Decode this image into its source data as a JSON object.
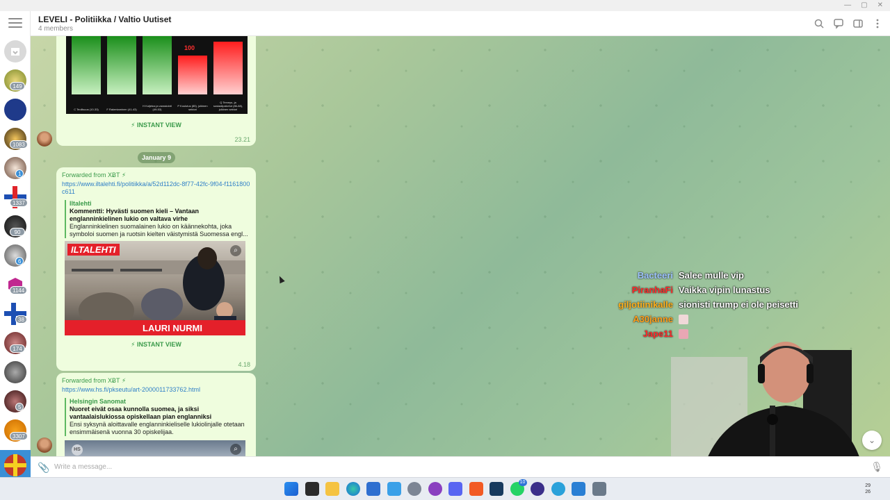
{
  "window": {
    "controls": [
      "—",
      "▢",
      "✕"
    ]
  },
  "header": {
    "title": "LEVELI - Politiikka / Valtio Uutiset",
    "subtitle": "4 members"
  },
  "rail": {
    "badges": [
      "149",
      "",
      "1083",
      "1",
      "1337",
      "90",
      "6",
      "1144",
      "38",
      "174",
      "",
      "5",
      "3307"
    ]
  },
  "messages": {
    "first": {
      "instant_view": "⚡ INSTANT VIEW",
      "time": "23.21",
      "chart_labels": [
        "C Teollisuus (10-33)",
        "F Rakentaminen (41-43)",
        "H Kuljetus ja varastointi (49-53)",
        "P Koulutus (85), julkinen sektori",
        "Q Terveys- ja sosiaalipalvelut (86-88), julkinen sektori"
      ],
      "chart_value": "100"
    },
    "date_pill": "January 9",
    "second": {
      "forwarded": "Forwarded from XɃT ⚡",
      "link": "https://www.iltalehti.fi/politiikka/a/52d112dc-8f77-42fc-9f04-f1161800c611",
      "site": "Iltalehti",
      "title": "Kommentti: Hyvästi suomen kieli – Vantaan englanninkielinen lukio on valtava virhe",
      "desc": "Englanninkielinen suomalainen lukio on käännekohta, joka symboloi suomen ja ruotsin kielten väistymistä Suomessa engl...",
      "image_logo": "ILTALEHTI",
      "image_name": "LAURI NURMI",
      "instant_view": "⚡ INSTANT VIEW",
      "time": "4.18"
    },
    "third": {
      "forwarded": "Forwarded from XɃT ⚡",
      "link": "https://www.hs.fi/pkseutu/art-2000011733762.html",
      "site": "Helsingin Sanomat",
      "title": "Nuoret eivät osaa kunnolla suomea, ja siksi vantaalaislukiossa opiskellaan pian englanniksi",
      "desc": "Ensi syksynä aloittavalle englanninkieliselle lukiolinjalle otetaan ensimmäisenä vuonna 30 opiskelijaa.",
      "image_logo": "HS"
    }
  },
  "composer": {
    "placeholder": "Write a message..."
  },
  "stream_chat": [
    {
      "name": "Bacteeri",
      "color": "#9fc4ff",
      "msg": "Salee mulle vip"
    },
    {
      "name": "PiranhaFi",
      "color": "#ff2a2a",
      "msg": "Vaikka vipin lunastus"
    },
    {
      "name": "giljotiinikalle",
      "color": "#ffae1a",
      "msg": "sionisti trump ei ole peisetti"
    },
    {
      "name": "A30janne",
      "color": "#ff9d1a",
      "msg": ""
    },
    {
      "name": "Jape11",
      "color": "#ff2a2a",
      "msg": ""
    }
  ],
  "taskbar": {
    "badges": {
      "whatsapp": "10"
    },
    "clock_time": "29",
    "clock_date": "26"
  }
}
